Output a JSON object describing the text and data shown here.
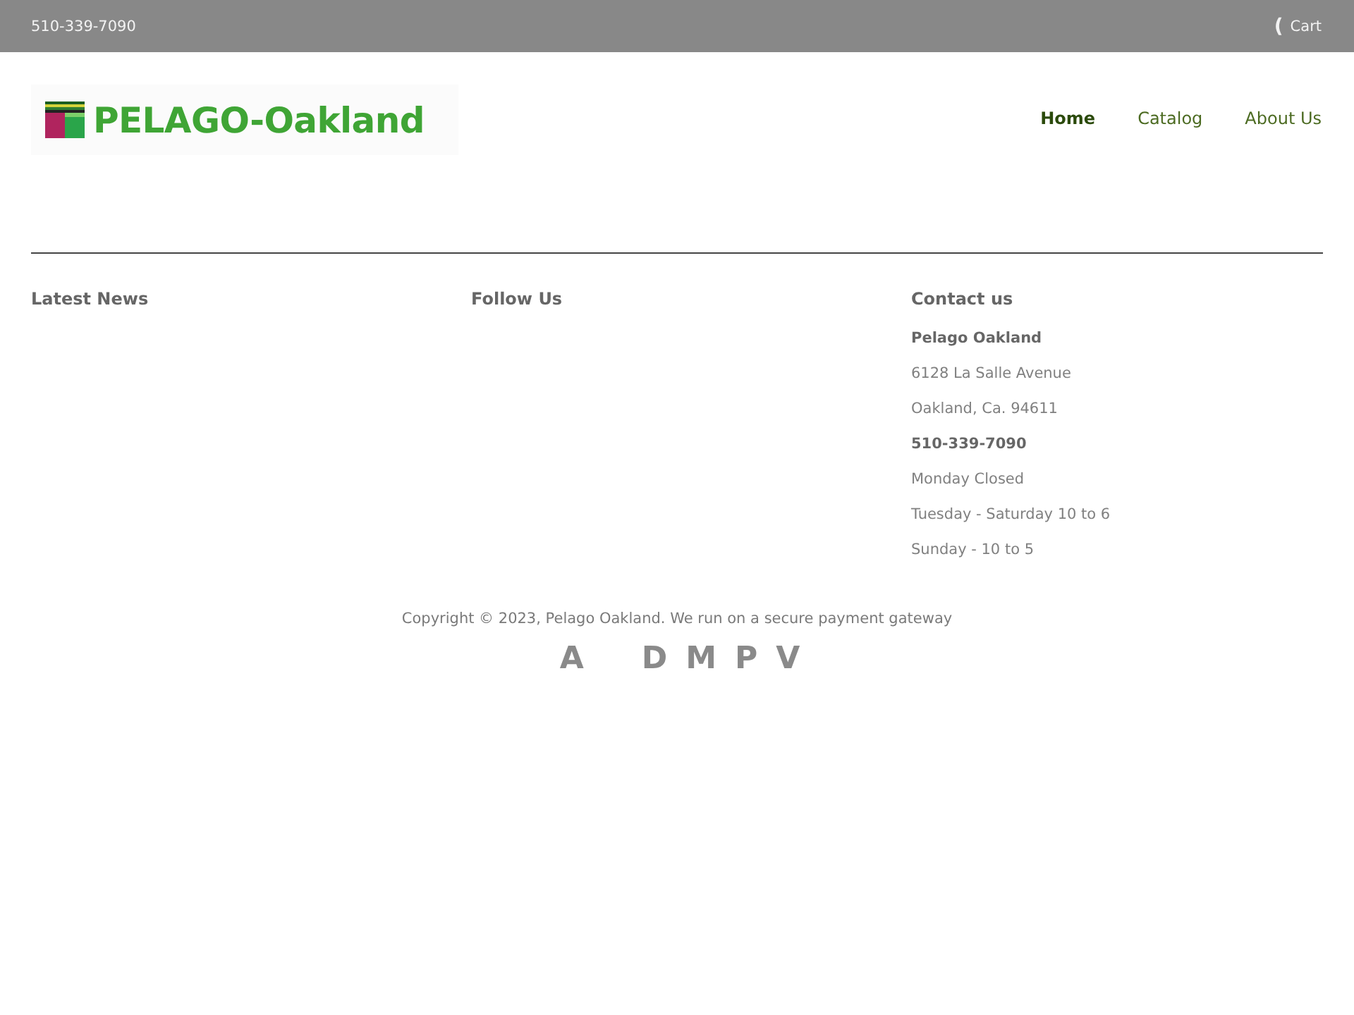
{
  "top_bar": {
    "phone": "510-339-7090",
    "cart": {
      "glyph": "(",
      "label": "Cart"
    }
  },
  "header": {
    "logo": {
      "text": "PELAGO-Oakland"
    },
    "nav": [
      {
        "label": "Home",
        "selected": true
      },
      {
        "label": "Catalog",
        "selected": false
      },
      {
        "label": "About Us",
        "selected": false
      }
    ]
  },
  "footer": {
    "columns": [
      {
        "heading": "Latest News"
      },
      {
        "heading": "Follow Us"
      },
      {
        "heading": "Contact us",
        "lines": [
          {
            "text": "Pelago Oakland",
            "kind": "bold"
          },
          {
            "text": "6128 La Salle Avenue",
            "kind": "plain"
          },
          {
            "text": "Oakland, Ca. 94611",
            "kind": "plain"
          },
          {
            "text": "510-339-7090",
            "kind": "bold"
          },
          {
            "text": "Monday Closed",
            "kind": "plain"
          },
          {
            "text": "Tuesday - Saturday 10 to 6",
            "kind": "plain"
          },
          {
            "text": "Sunday - 10 to 5",
            "kind": "plain"
          }
        ]
      }
    ],
    "copyright": "Copyright © 2023, Pelago Oakland. We run on a secure payment gateway",
    "payment_icons": [
      "A",
      "D",
      "M",
      "P",
      "V"
    ]
  }
}
